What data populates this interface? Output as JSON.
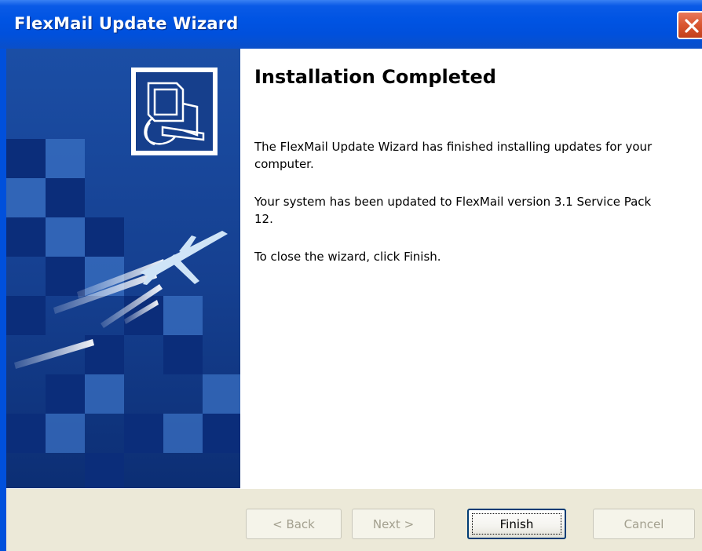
{
  "window": {
    "title": "FlexMail Update Wizard"
  },
  "content": {
    "heading": "Installation Completed",
    "paragraph_1": "The FlexMail Update Wizard has finished installing updates for your computer.",
    "paragraph_2": "Your system has been updated to FlexMail version 3.1 Service Pack 12.",
    "paragraph_3": "To close the wizard, click Finish."
  },
  "buttons": {
    "back_label": "< Back",
    "next_label": "Next >",
    "finish_label": "Finish",
    "cancel_label": "Cancel"
  },
  "icons": {
    "close": "close-icon",
    "banner_logo": "computer-setup-icon",
    "banner_image": "airplane-illustration"
  },
  "colors": {
    "title_bar": "#0054e3",
    "banner_background": "#0f3f93",
    "banner_light_squares": "#3a70c2",
    "close_button": "#d9552f",
    "button_face": "#ece9d8"
  }
}
